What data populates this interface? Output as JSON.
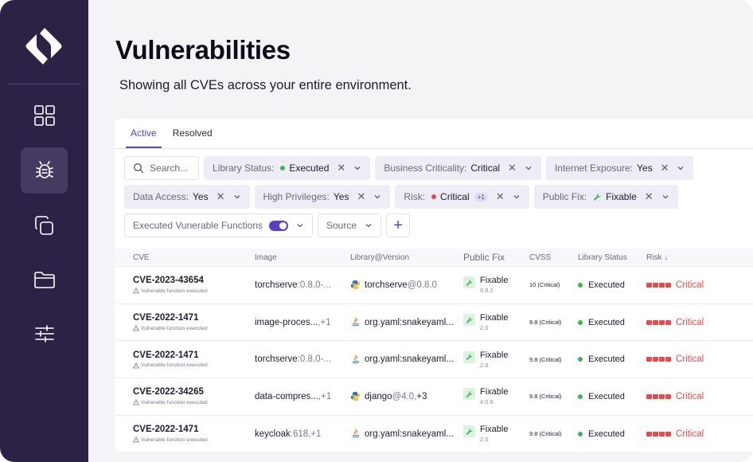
{
  "page": {
    "title": "Vulnerabilities",
    "subtitle": "Showing all CVEs across your entire environment."
  },
  "tabs": [
    {
      "label": "Active",
      "active": true
    },
    {
      "label": "Resolved",
      "active": false
    }
  ],
  "search": {
    "placeholder": "Search..."
  },
  "filters": {
    "library_status": {
      "label": "Library Status:",
      "value": "Executed",
      "dot_color": "#3db35a"
    },
    "business_criticality": {
      "label": "Business Criticality:",
      "value": "Critical"
    },
    "internet_exposure": {
      "label": "Internet Exposure:",
      "value": "Yes"
    },
    "data_access": {
      "label": "Data Access:",
      "value": "Yes"
    },
    "high_privileges": {
      "label": "High Privileges:",
      "value": "Yes"
    },
    "risk": {
      "label": "Risk:",
      "value": "Critical",
      "badge": "+1",
      "dot_color": "#e54b4b"
    },
    "public_fix": {
      "label": "Public Fix:",
      "value": "Fixable"
    },
    "executed_functions": {
      "label": "Executed Vunerable Functions",
      "enabled": true
    },
    "source": {
      "label": "Source"
    },
    "clear_symbol": "✕",
    "add_symbol": "+"
  },
  "columns": {
    "cve": "CVE",
    "image": "Image",
    "library": "Library@Version",
    "public_fix": "Public Fix",
    "cvss": "CVSS",
    "library_status": "Library Status",
    "risk": "Risk",
    "risk_sort_icon": "↓"
  },
  "rows": [
    {
      "cve": "CVE-2023-43654",
      "note": "Vulnerable function executed",
      "image_name": "torchserve",
      "image_version": ":0.8.0-...",
      "lib_icon": "python-icon",
      "lib_name": "torchserve",
      "lib_version": " @0.8.0",
      "lib_extra": "",
      "fix": "Fixable",
      "fix_version": "0.8.2",
      "cvss": "10 (Critical)",
      "status": "Executed",
      "risk": "Critical"
    },
    {
      "cve": "CVE-2022-1471",
      "note": "Vulnerable function executed",
      "image_name": "image-proces...",
      "image_version": ",+1",
      "lib_icon": "java-icon",
      "lib_name": "org.yaml:snakeyaml...",
      "lib_version": "",
      "lib_extra": "",
      "fix": "Fixable",
      "fix_version": "2.0",
      "cvss": "9.8 (Critical)",
      "status": "Executed",
      "risk": "Critical"
    },
    {
      "cve": "CVE-2022-1471",
      "note": "Vulnerable function executed",
      "image_name": "torchserve",
      "image_version": ":0.8.0-...",
      "lib_icon": "java-icon",
      "lib_name": "org.yaml:snakeyaml...",
      "lib_version": "",
      "lib_extra": "",
      "fix": "Fixable",
      "fix_version": "2.0",
      "cvss": "9.8 (Critical)",
      "status": "Executed",
      "risk": "Critical"
    },
    {
      "cve": "CVE-2022-34265",
      "note": "Vulnerable function executed",
      "image_name": "data-compres...",
      "image_version": ",+1",
      "lib_icon": "python-icon",
      "lib_name": "django",
      "lib_version": "@4.0,",
      "lib_extra": " +3",
      "fix": "Fixable",
      "fix_version": "4.0.6",
      "cvss": "9.8 (Critical)",
      "status": "Executed",
      "risk": "Critical"
    },
    {
      "cve": "CVE-2022-1471",
      "note": "Vulnerable function executed",
      "image_name": "keycloak",
      "image_version": ":618,+1",
      "lib_icon": "java-icon",
      "lib_name": "org.yaml:snakeyaml...",
      "lib_version": "",
      "lib_extra": "",
      "fix": "Fixable",
      "fix_version": "2.0",
      "cvss": "9.8 (Critical)",
      "status": "Executed",
      "risk": "Critical"
    }
  ],
  "colors": {
    "sidebar": "#2d2145",
    "accent": "#5a40c7",
    "critical": "#e54b4b",
    "executed": "#3db35a"
  }
}
